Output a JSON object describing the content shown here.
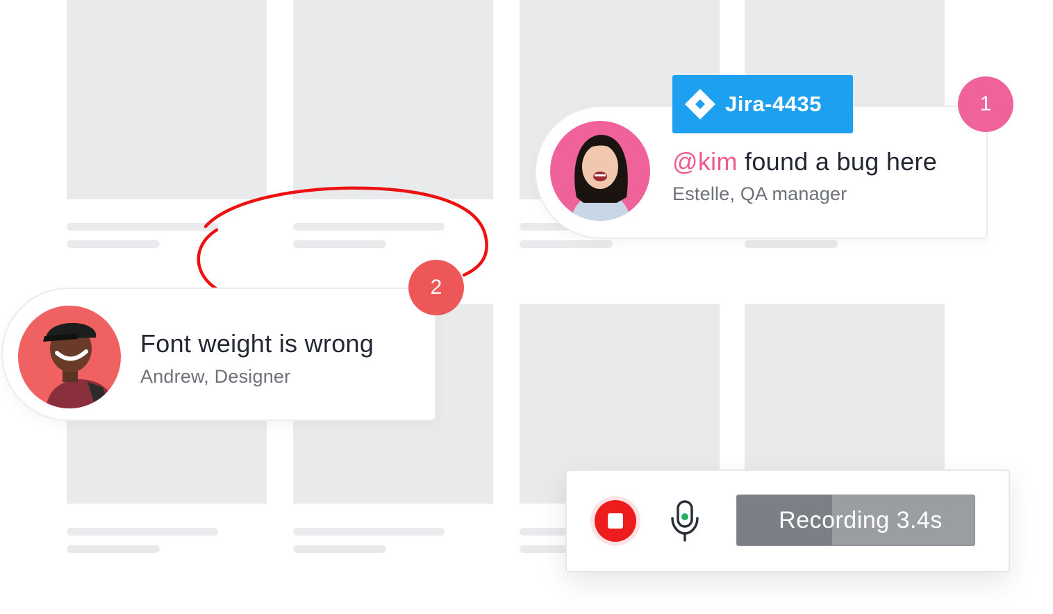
{
  "comments": [
    {
      "badge": "1",
      "mention": "@kim",
      "title_rest": " found a bug here",
      "author": "Estelle, QA manager",
      "avatar_bg": "#f0629a",
      "badge_color": "#f0629a",
      "tag": {
        "label": "Jira-4435",
        "icon": "jira-diamond-icon",
        "color": "#1ea0f0"
      }
    },
    {
      "badge": "2",
      "title": "Font weight is wrong",
      "author": "Andrew, Designer",
      "avatar_bg": "#f06262",
      "badge_color": "#ee5757"
    }
  ],
  "annotation": {
    "stroke_color": "#ee1111"
  },
  "recorder": {
    "stop_icon": "stop-icon",
    "mic_icon": "microphone-icon",
    "label": "Recording 3.4s",
    "progress": 0.4
  },
  "colors": {
    "placeholder": "#e9eaeb",
    "accent_green": "#27ae60"
  }
}
